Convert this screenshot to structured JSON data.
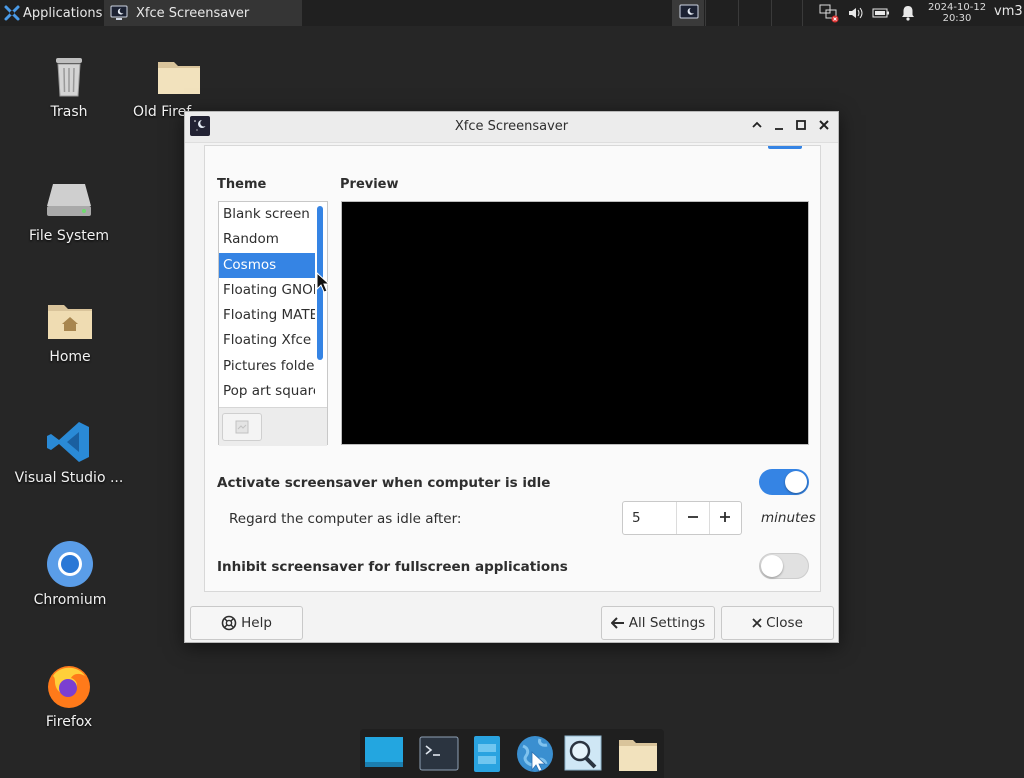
{
  "top_panel": {
    "applications_label": "Applications",
    "task_title": "Xfce Screensaver",
    "clock_date": "2024-10-12",
    "clock_time": "20:30",
    "user": "vm3"
  },
  "desktop_icons": [
    {
      "label": "Trash",
      "icon": "trash-icon"
    },
    {
      "label": "Old Firef",
      "icon": "folder-icon"
    },
    {
      "label": "File System",
      "icon": "drive-icon"
    },
    {
      "label": "Home",
      "icon": "home-folder-icon"
    },
    {
      "label": "Visual Studio ...",
      "icon": "vscode-icon"
    },
    {
      "label": "Chromium",
      "icon": "chromium-icon"
    },
    {
      "label": "Firefox",
      "icon": "firefox-icon"
    }
  ],
  "dialog": {
    "title": "Xfce Screensaver",
    "theme_label": "Theme",
    "preview_label": "Preview",
    "themes": [
      "Blank screen",
      "Random",
      "Cosmos",
      "Floating GNOME",
      "Floating MATE",
      "Floating Xfce",
      "Pictures folder",
      "Pop art squares"
    ],
    "selected_theme": "Cosmos",
    "activate_label": "Activate screensaver when computer is idle",
    "activate_enabled": true,
    "idle_label": "Regard the computer as idle after:",
    "idle_value": "5",
    "idle_units": "minutes",
    "inhibit_label": "Inhibit screensaver for fullscreen applications",
    "inhibit_enabled": false,
    "help_label": "Help",
    "all_settings_label": "All Settings",
    "close_label": "Close",
    "accent_color": "#3584e4"
  },
  "dock_items": [
    "desktop-icon",
    "terminal-icon",
    "file-manager-icon",
    "web-browser-icon",
    "app-finder-icon",
    "folder-icon"
  ]
}
